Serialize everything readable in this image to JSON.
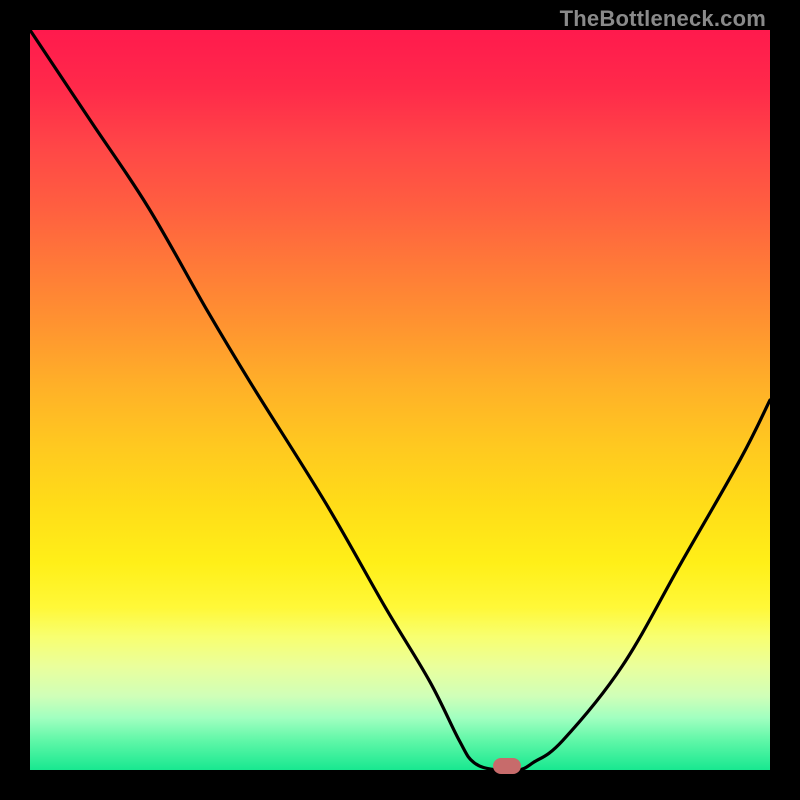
{
  "watermark": "TheBottleneck.com",
  "colors": {
    "background": "#000000",
    "curve": "#000000",
    "marker": "#c76b6b"
  },
  "chart_data": {
    "type": "line",
    "title": "",
    "xlabel": "",
    "ylabel": "",
    "xlim": [
      0,
      100
    ],
    "ylim": [
      0,
      100
    ],
    "grid": false,
    "legend": false,
    "series": [
      {
        "name": "bottleneck-curve",
        "x": [
          0,
          8,
          16,
          24,
          30,
          40,
          48,
          54,
          58,
          60,
          63,
          66,
          68,
          72,
          80,
          88,
          96,
          100
        ],
        "values": [
          100,
          88,
          76,
          62,
          52,
          36,
          22,
          12,
          4,
          1,
          0,
          0,
          1,
          4,
          14,
          28,
          42,
          50
        ]
      }
    ],
    "marker": {
      "x": 64.5,
      "y": 0.5,
      "shape": "pill"
    },
    "background_gradient": {
      "direction": "vertical",
      "stops": [
        {
          "pos": 0,
          "color": "#ff1a4d"
        },
        {
          "pos": 50,
          "color": "#ffb028"
        },
        {
          "pos": 78,
          "color": "#fff838"
        },
        {
          "pos": 100,
          "color": "#18e890"
        }
      ]
    }
  }
}
